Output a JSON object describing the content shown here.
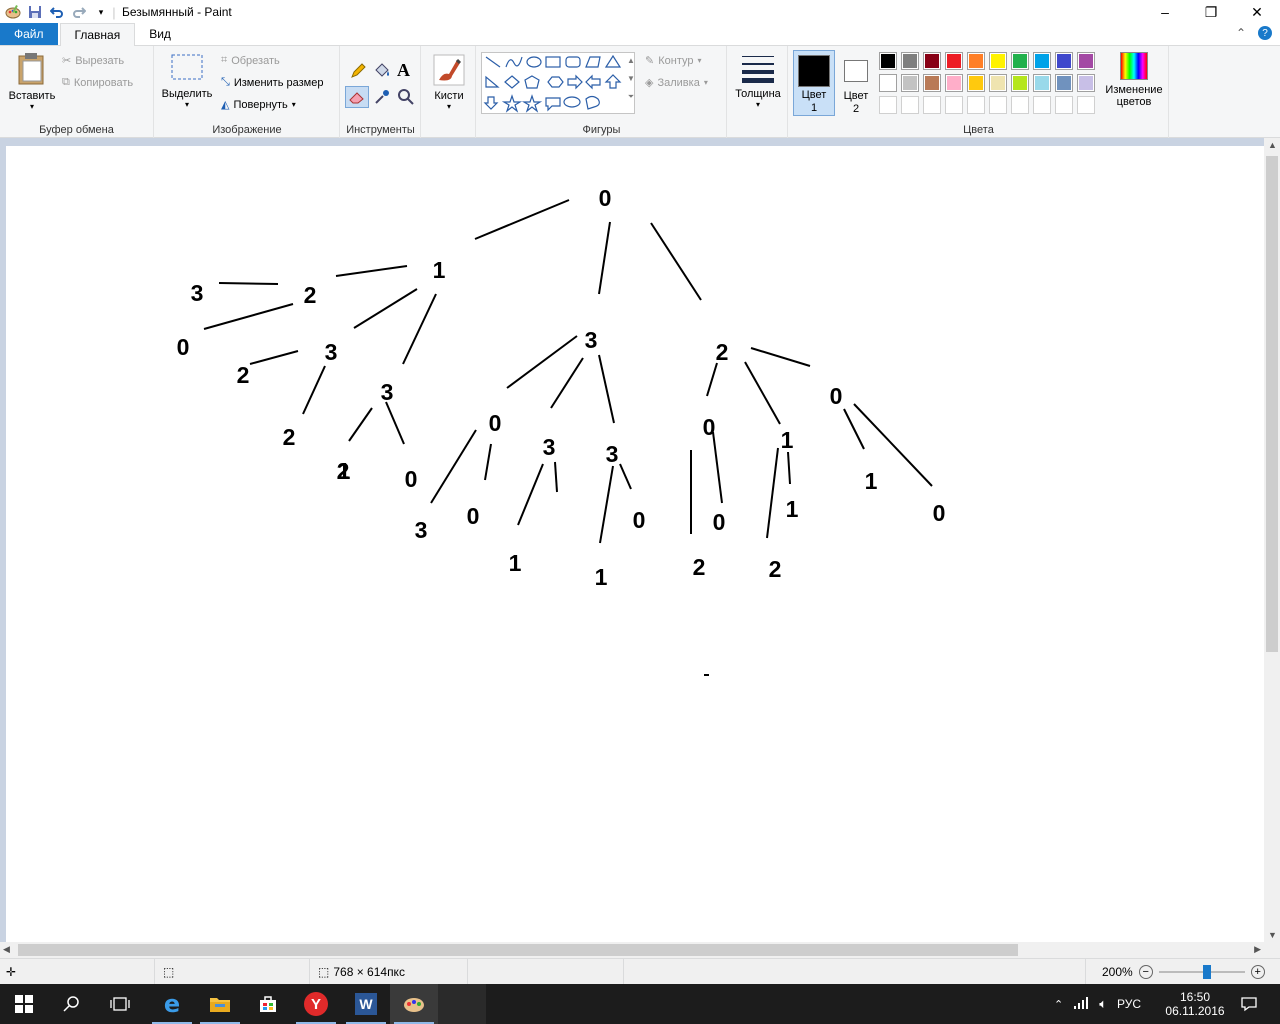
{
  "window": {
    "title": "Безымянный - Paint"
  },
  "tabs": [
    {
      "label": "Файл"
    },
    {
      "label": "Главная"
    },
    {
      "label": "Вид"
    }
  ],
  "ribbon": {
    "clipboard": {
      "group_label": "Буфер обмена",
      "paste": "Вставить",
      "cut": "Вырезать",
      "copy": "Копировать"
    },
    "image": {
      "group_label": "Изображение",
      "select": "Выделить",
      "crop": "Обрезать",
      "resize": "Изменить размер",
      "rotate": "Повернуть"
    },
    "tools": {
      "group_label": "Инструменты"
    },
    "brushes": {
      "label": "Кисти"
    },
    "shapes": {
      "group_label": "Фигуры",
      "outline": "Контур",
      "fill": "Заливка"
    },
    "size": {
      "label": "Толщина"
    },
    "colors": {
      "group_label": "Цвета",
      "color1": "Цвет 1",
      "color2": "Цвет 2",
      "edit": "Изменение цветов",
      "palette_row1": [
        "#000000",
        "#7f7f7f",
        "#880015",
        "#ed1c24",
        "#ff7f27",
        "#fff200",
        "#22b14c",
        "#00a2e8",
        "#3f48cc",
        "#a349a4"
      ],
      "palette_row2": [
        "#ffffff",
        "#c3c3c3",
        "#b97a57",
        "#ffaec9",
        "#ffc90e",
        "#efe4b0",
        "#b5e61d",
        "#99d9ea",
        "#7092be",
        "#c8bfe7"
      ]
    }
  },
  "canvas": {
    "nodes": [
      {
        "label": "0"
      },
      {
        "label": "1"
      },
      {
        "label": "2"
      },
      {
        "label": "3"
      },
      {
        "label": "3"
      },
      {
        "label": "2"
      },
      {
        "label": "0"
      },
      {
        "label": "0"
      },
      {
        "label": "2"
      },
      {
        "label": "3"
      },
      {
        "label": "3"
      },
      {
        "label": "2"
      },
      {
        "label": "0"
      },
      {
        "label": "1"
      },
      {
        "label": "0"
      },
      {
        "label": "3"
      },
      {
        "label": "3"
      },
      {
        "label": "0"
      },
      {
        "label": "1"
      },
      {
        "label": "3"
      },
      {
        "label": "0"
      },
      {
        "label": "1"
      },
      {
        "label": "1"
      },
      {
        "label": "0"
      },
      {
        "label": "2"
      },
      {
        "label": "0"
      },
      {
        "label": "2"
      },
      {
        "label": "1"
      },
      {
        "label": "2"
      },
      {
        "label": "1"
      },
      {
        "label": "0"
      }
    ]
  },
  "status": {
    "size": "768 × 614пкс",
    "zoom": "200%"
  },
  "taskbar": {
    "time": "16:50",
    "date": "06.11.2016",
    "lang": "РУС"
  }
}
